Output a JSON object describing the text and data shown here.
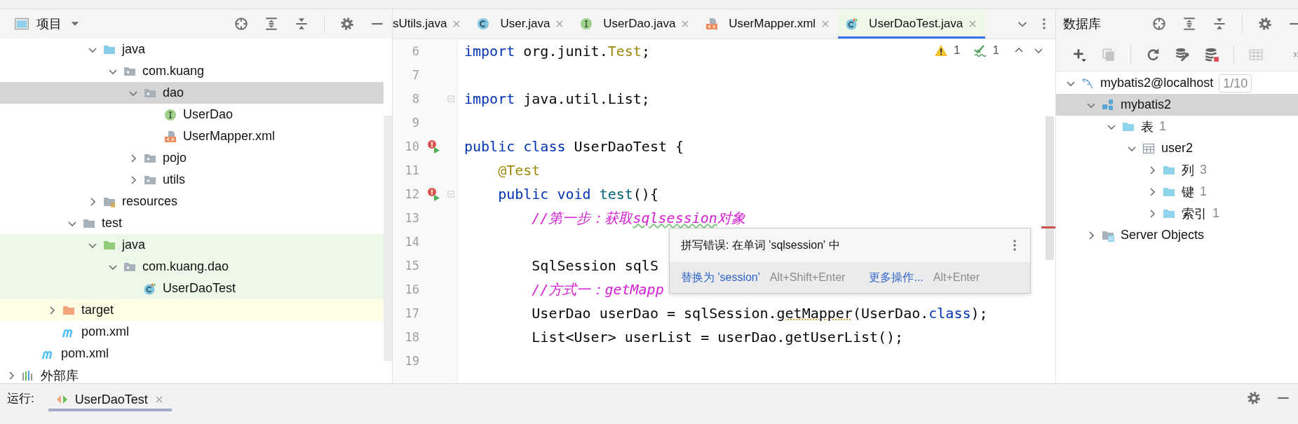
{
  "project_panel": {
    "title": "项目",
    "tree": [
      {
        "children": [
          {
            "children": [
              {
                "children": [
                  {
                    "children": [
                      {
                        "label": "java",
                        "kind": "source-folder",
                        "expanded": true,
                        "selected": false,
                        "children": [
                          {
                            "label": "com.kuang",
                            "kind": "package",
                            "expanded": true,
                            "selected": false,
                            "children": [
                              {
                                "label": "dao",
                                "kind": "package",
                                "expanded": true,
                                "selected": true,
                                "children": [
                                  {
                                    "label": "UserDao",
                                    "kind": "interface",
                                    "selected": false
                                  },
                                  {
                                    "label": "UserMapper.xml",
                                    "kind": "xml",
                                    "selected": false
                                  }
                                ]
                              },
                              {
                                "label": "pojo",
                                "kind": "package",
                                "expanded": false,
                                "selected": false
                              },
                              {
                                "label": "utils",
                                "kind": "package",
                                "expanded": false,
                                "selected": false
                              }
                            ]
                          }
                        ]
                      },
                      {
                        "label": "resources",
                        "kind": "resources-folder",
                        "expanded": false,
                        "selected": false
                      }
                    ]
                  },
                  {
                    "label": "test",
                    "kind": "folder",
                    "expanded": true,
                    "selected": false,
                    "children": [
                      {
                        "label": "java",
                        "kind": "test-folder",
                        "expanded": true,
                        "selected": false,
                        "color": "#eef8e8",
                        "children": [
                          {
                            "label": "com.kuang.dao",
                            "kind": "package",
                            "expanded": true,
                            "selected": false,
                            "color": "#eef8e8",
                            "children": [
                              {
                                "label": "UserDaoTest",
                                "kind": "test-class",
                                "selected": false,
                                "color": "#eef8e8"
                              }
                            ]
                          }
                        ]
                      }
                    ]
                  }
                ]
              },
              {
                "label": "target",
                "kind": "excluded-folder",
                "expanded": false,
                "selected": false,
                "color": "#fefde6"
              },
              {
                "label": "pom.xml",
                "kind": "maven",
                "selected": false
              }
            ]
          },
          {
            "label": "pom.xml",
            "kind": "maven",
            "selected": false
          }
        ]
      },
      {
        "label": "外部库",
        "kind": "library",
        "expanded": false,
        "selected": false
      }
    ]
  },
  "editor": {
    "tabs": [
      {
        "label": "sUtils.java",
        "kind": "partial",
        "selected": false
      },
      {
        "label": "User.java",
        "kind": "class",
        "selected": false
      },
      {
        "label": "UserDao.java",
        "kind": "interface",
        "selected": false
      },
      {
        "label": "UserMapper.xml",
        "kind": "xml",
        "selected": false
      },
      {
        "label": "UserDaoTest.java",
        "kind": "test-class",
        "selected": true
      }
    ],
    "inspections": [
      {
        "kind": "warning",
        "count": "1"
      },
      {
        "kind": "ok",
        "count": "1"
      }
    ],
    "lines": [
      {
        "number": "6",
        "segments": [
          {
            "text": "import",
            "kind": "kw"
          },
          {
            "text": " org.junit.",
            "kind": "plain"
          },
          {
            "text": "Test",
            "kind": "type"
          },
          {
            "text": ";",
            "kind": "plain"
          }
        ]
      },
      {
        "number": "7"
      },
      {
        "number": "8",
        "fold": true,
        "segments": [
          {
            "text": "import",
            "kind": "kw"
          },
          {
            "text": " java.util.List;",
            "kind": "plain"
          }
        ]
      },
      {
        "number": "9"
      },
      {
        "number": "10",
        "run_failed": true,
        "segments": [
          {
            "text": "public class",
            "kind": "kw"
          },
          {
            "text": " UserDaoTest {",
            "kind": "plain"
          }
        ]
      },
      {
        "number": "11",
        "segments": [
          {
            "text": "    @Test",
            "kind": "ann"
          }
        ]
      },
      {
        "number": "12",
        "run_failed": true,
        "fold": true,
        "segments": [
          {
            "text": "    public void ",
            "kind": "kw"
          },
          {
            "text": "test",
            "kind": "method"
          },
          {
            "text": "(){",
            "kind": "plain"
          }
        ]
      },
      {
        "number": "13",
        "segments": [
          {
            "text": "        //第一步：获取",
            "kind": "comment"
          },
          {
            "text": "sqlsession",
            "kind": "typo"
          },
          {
            "text": "对象",
            "kind": "comment"
          }
        ]
      },
      {
        "number": "14"
      },
      {
        "number": "15",
        "segments": [
          {
            "text": "        SqlSession sqlS",
            "kind": "plain"
          }
        ]
      },
      {
        "number": "16",
        "segments": [
          {
            "text": "        //方式一：getMapp",
            "kind": "comment"
          }
        ]
      },
      {
        "number": "17",
        "segments": [
          {
            "text": "        UserDao userDao = sqlSession.",
            "kind": "plain"
          },
          {
            "text": "getMapper",
            "kind": "warn"
          },
          {
            "text": "(UserDao.",
            "kind": "plain"
          },
          {
            "text": "class",
            "kind": "kw"
          },
          {
            "text": ");",
            "kind": "plain"
          }
        ]
      },
      {
        "number": "18",
        "segments": [
          {
            "text": "        List<User> userList = userDao.getUserList();",
            "kind": "plain"
          }
        ]
      },
      {
        "number": "19"
      }
    ],
    "popup": {
      "message": "拼写错误: 在单词 'sqlsession' 中",
      "actions": [
        {
          "label": "替换为 'session'",
          "shortcut": "Alt+Shift+Enter"
        },
        {
          "label": "更多操作...",
          "shortcut": "Alt+Enter"
        }
      ]
    }
  },
  "database_panel": {
    "title": "数据库",
    "tree": [
      {
        "label": "mybatis2@localhost",
        "kind": "connection",
        "badge": "1/10",
        "expanded": true,
        "selected": false,
        "children": [
          {
            "label": "mybatis2",
            "kind": "schema",
            "expanded": true,
            "selected": true,
            "children": [
              {
                "label": "表",
                "count": "1",
                "kind": "group-folder",
                "expanded": true,
                "selected": false,
                "children": [
                  {
                    "label": "user2",
                    "kind": "table",
                    "expanded": true,
                    "selected": false,
                    "children": [
                      {
                        "label": "列",
                        "count": "3",
                        "kind": "group-folder",
                        "expanded": false,
                        "selected": false
                      },
                      {
                        "label": "键",
                        "count": "1",
                        "kind": "group-folder",
                        "expanded": false,
                        "selected": false
                      },
                      {
                        "label": "索引",
                        "count": "1",
                        "kind": "group-folder",
                        "expanded": false,
                        "selected": false
                      }
                    ]
                  }
                ]
              }
            ]
          },
          {
            "label": "Server Objects",
            "kind": "server-objects",
            "expanded": false,
            "selected": false
          }
        ]
      }
    ]
  },
  "run_panel": {
    "label": "运行:",
    "tabs": [
      {
        "label": "UserDaoTest",
        "selected": true
      }
    ]
  }
}
